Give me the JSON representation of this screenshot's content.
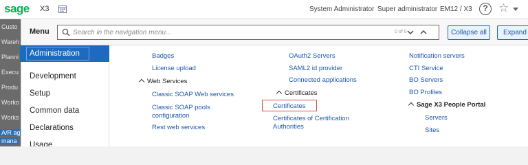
{
  "app": {
    "brand": "sage",
    "product": "X3",
    "user_name": "System Administrator",
    "role": "Super administrator",
    "folder": "EM12 / X3"
  },
  "icons": {
    "calendar": "calendar-icon",
    "help": "help-icon",
    "favorite": "star-icon",
    "dropdown": "chevron-down-icon",
    "search": "search-icon",
    "accent": "#1d6ac0",
    "brand_green": "#00b451",
    "highlight_border": "#d64b4b"
  },
  "under_strip": [
    "Custo",
    "Wareh",
    "Planni",
    "Execu",
    "Produ",
    "Worko",
    "Works",
    "A/R ag",
    "mana"
  ],
  "menu": {
    "title": "Menu",
    "search_placeholder": "Search in the navigation menu...",
    "search_count": "0 of 0",
    "collapse_label": "Collapse all",
    "expand_label": "Expand all"
  },
  "categories": [
    {
      "label": "Administration",
      "active": true
    },
    {
      "label": "Development",
      "active": false
    },
    {
      "label": "Setup",
      "active": false
    },
    {
      "label": "Common data",
      "active": false
    },
    {
      "label": "Declarations",
      "active": false
    },
    {
      "label": "Usage",
      "active": false
    }
  ],
  "col1": {
    "badges": "Badges",
    "license_upload": "License upload",
    "web_services": "Web Services",
    "classic_soap": "Classic SOAP Web services",
    "classic_soap_pools": "Classic SOAP pools",
    "configuration": "configuration",
    "rest": "Rest web services"
  },
  "col2": {
    "oauth2": "OAuth2 Servers",
    "saml2": "SAML2 id provider",
    "connected": "Connected applications",
    "certificates_group": "Certificates",
    "certificates": "Certificates",
    "cert_auth_1": "Certificates of Certification",
    "cert_auth_2": "Authorities"
  },
  "col3": {
    "notification": "Notification servers",
    "cti": "CTI Service",
    "bo_servers": "BO Servers",
    "bo_profiles": "BO Profiles",
    "people_portal": "Sage X3 People Portal",
    "servers": "Servers",
    "sites": "Sites"
  }
}
